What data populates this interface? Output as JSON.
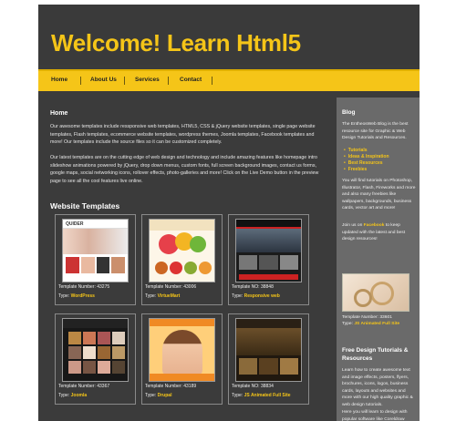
{
  "header": {
    "title": "Welcome! Learn Html5"
  },
  "nav": {
    "items": [
      "Home",
      "About Us",
      "Services",
      "Contact"
    ]
  },
  "main": {
    "heading": "Home",
    "intro": "Our awesome templates include ressponsive web templates, HTML5, CSS & jQuery website templates, single page website templates, Flash templates, ecommerce website templates, wordpress themes, Joomla templates, Facebook templates and more! Our templates include the source files so it can be customized completely.",
    "details": "Our latest templates are on the cutting edge of web design and technology and include amazing features like homepage intro slideshow animations powered by jQuery, drop down menus, custom fonts, full screen background images, contact us forms, google maps, social networking icons, rollover effects, photo-galleries and more! Click on the Live Demo button in the preview page to see all the cool features live online.",
    "templates_title": "Website Templates",
    "cards": [
      {
        "number": "Template Number: 43275",
        "type_label": "Type: ",
        "type": "WordPress",
        "thumb_text": "QUIDER"
      },
      {
        "number": "Template Number: 43006",
        "type_label": "Type: ",
        "type": "VirtueMart",
        "thumb_text": ""
      },
      {
        "number": "Template NO: 38848",
        "type_label": "Type: ",
        "type": "Responsive web",
        "thumb_text": ""
      },
      {
        "number": "Template Number: 43367",
        "type_label": "Type: ",
        "type": "Joomla",
        "thumb_text": ""
      },
      {
        "number": "Template Number: 43189",
        "type_label": "Type: ",
        "type": "Drupal",
        "thumb_text": ""
      },
      {
        "number": "Template NO: 38834",
        "type_label": "Type: ",
        "type": "JS Animated Full Site",
        "thumb_text": ""
      }
    ]
  },
  "sidebar": {
    "blog_title": "Blog",
    "blog_text": "The EntheosWeb Blog is the best resource site for Graphic & Web Design Tutorials and Resources.",
    "links": [
      "Tutorials",
      "Ideas & Inspiration",
      "Best Resources",
      "Freebies"
    ],
    "tutorials_text": "You will find tutorials on Photoshop, Illustrator, Flash, Fireworks and more and also many freebies like wallpapers, backgrounds, business cards, vector art and more!",
    "facebook_pre": "Join us on ",
    "facebook_link": "Facebook",
    "facebook_post": " to keep updated with the latest and best design resources!",
    "featured_number": "Template Number: 33601",
    "featured_type_label": "Type: ",
    "featured_type": "JS Animated Full Site",
    "free_title": "Free Design Tutorials & Resources",
    "free_text": "Learn how to create awesome text and image effects, posters, flyers, brochures, icons, logos, business cards, layouts and websites and more with our high quality graphic & web design tutorials.",
    "free_text2": "Here you will learn to design with popular software like Coreldraw"
  },
  "colors": {
    "accent": "#f5c518",
    "page_bg": "#3b3b3b",
    "sidebar_bg": "#6a6a6a"
  }
}
